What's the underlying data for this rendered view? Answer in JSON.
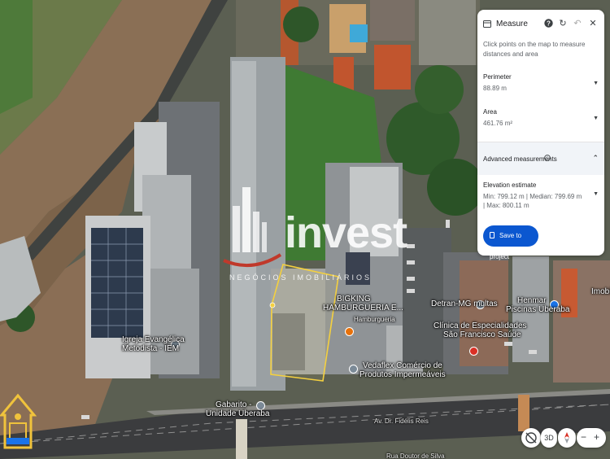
{
  "map": {
    "labels": [
      {
        "text": "BIGKING",
        "icon": "food-pin-icon"
      },
      {
        "text": "HAMBURGUERIA E...",
        "icon": ""
      },
      {
        "text": "Hamburgueria",
        "icon": ""
      },
      {
        "text": "Detran-MG multas",
        "icon": "gov-pin-icon"
      },
      {
        "text": "Henmar",
        "icon": "store-pin-icon"
      },
      {
        "text": "Piscinas Uberaba",
        "icon": ""
      },
      {
        "text": "Imobil...",
        "icon": ""
      },
      {
        "text": "Igreja Evangélica",
        "icon": "church-pin-icon"
      },
      {
        "text": "Metodista - IEM",
        "icon": ""
      },
      {
        "text": "Clínica de Especialidades",
        "icon": "medical-pin-icon"
      },
      {
        "text": "São Francisco Saúde",
        "icon": ""
      },
      {
        "text": "Vedaflex Comércio de",
        "icon": "store-pin-icon"
      },
      {
        "text": "Produtos Impermeáveis",
        "icon": ""
      },
      {
        "text": "Gabarito -",
        "icon": "school-pin-icon"
      },
      {
        "text": "Unidade Uberaba",
        "icon": ""
      },
      {
        "text": "Av. Dr. Fidélis Reis",
        "icon": ""
      },
      {
        "text": "Rua Doutor de Silva",
        "icon": ""
      }
    ]
  },
  "watermark": {
    "word": "invest",
    "subtitle": "NEGÓCIOS IMOBILIÁRIOS"
  },
  "panel": {
    "title": "Measure",
    "description": "Click points on the map to measure distances and area",
    "perimeter_label": "Perimeter",
    "perimeter_value": "88.89 m",
    "area_label": "Area",
    "area_value": "461.76 m²",
    "advanced_label": "Advanced measurements",
    "elevation_label": "Elevation estimate",
    "elevation_value": "Min: 799.12 m | Median: 799.69 m | Max: 800.11 m",
    "save_label": "Save to project"
  },
  "controls": {
    "view_3d": "3D",
    "zoom_out": "−",
    "zoom_in": "+"
  },
  "colors": {
    "accent": "#0b57d0",
    "measure_line": "#f4d03f",
    "logo": "#f0c33c"
  }
}
